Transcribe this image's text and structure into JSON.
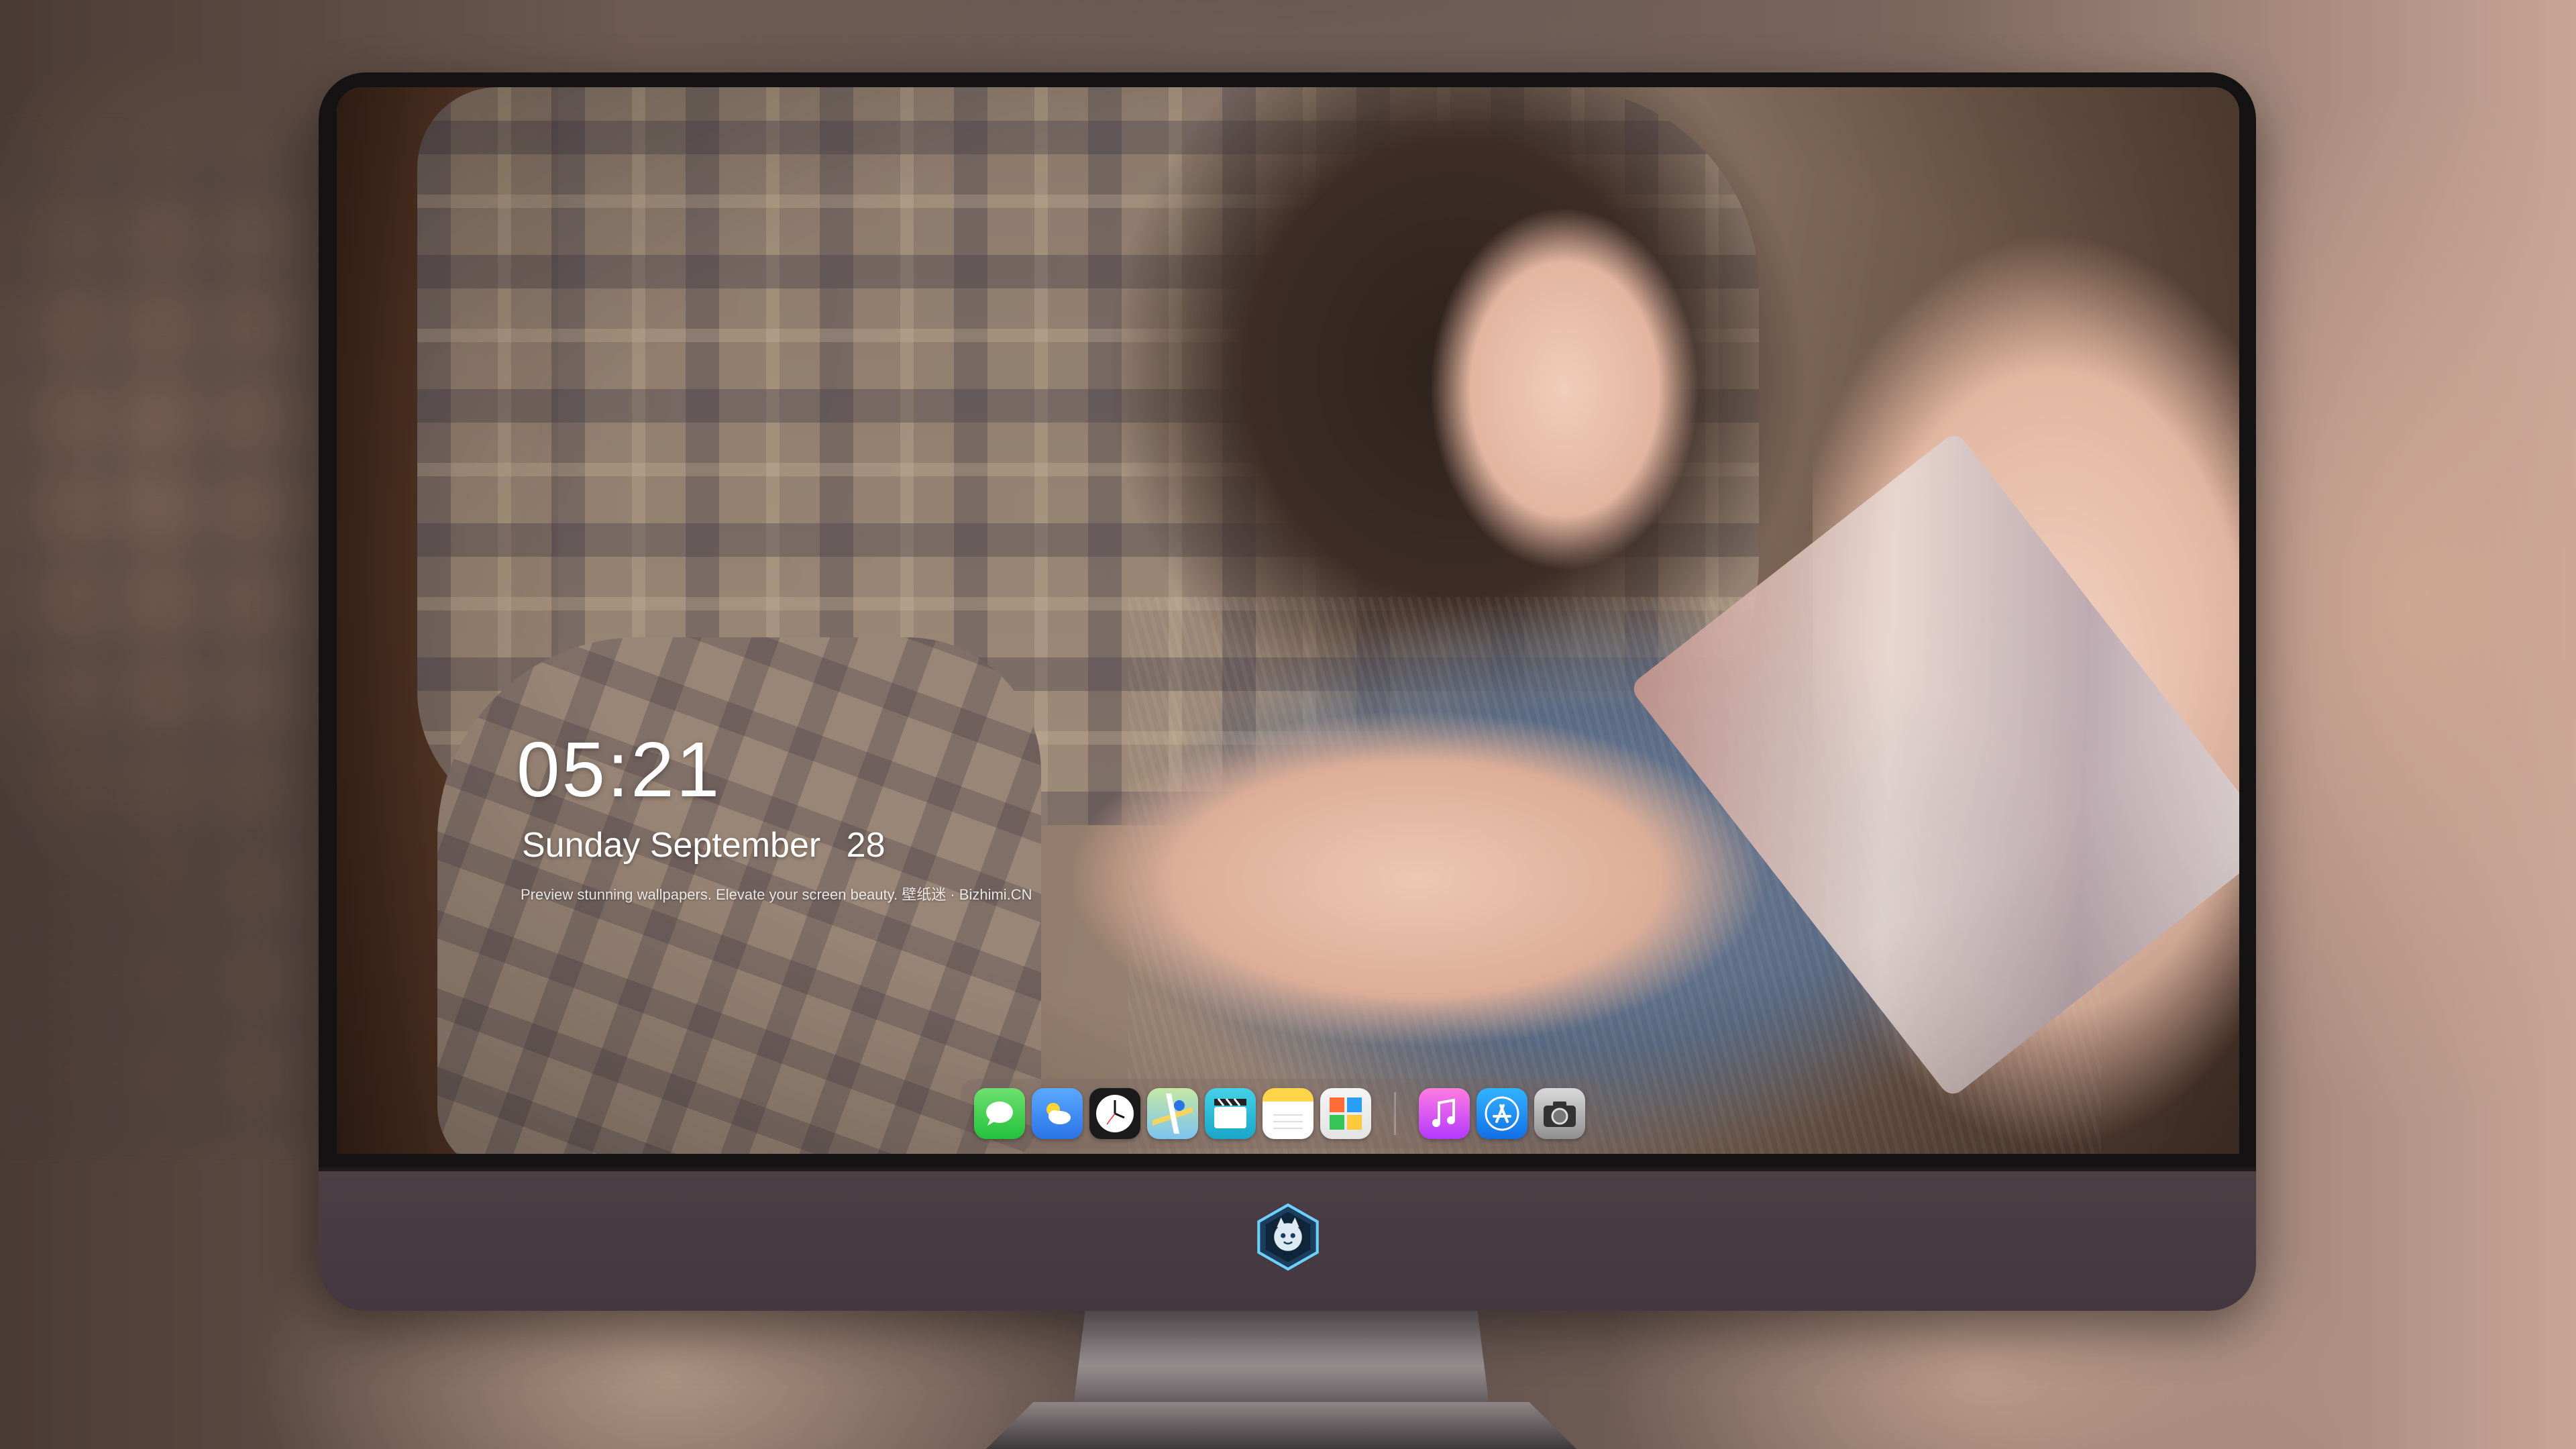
{
  "clock": {
    "time": "05:21",
    "weekday": "Sunday",
    "month": "September",
    "day": "28",
    "tagline": "Preview stunning wallpapers. Elevate your screen beauty. 壁纸迷 · Bizhimi.CN"
  },
  "dock": {
    "apps": [
      {
        "name": "Messages",
        "icon": "messages-icon",
        "color": "#28c840"
      },
      {
        "name": "Weather",
        "icon": "weather-icon",
        "color": "#2f7fe9"
      },
      {
        "name": "Clock",
        "icon": "clock-icon",
        "color": "#1a1a1a"
      },
      {
        "name": "Maps",
        "icon": "maps-icon",
        "color": "#7cc3f0"
      },
      {
        "name": "Clips",
        "icon": "clips-icon",
        "color": "#19a6c9"
      },
      {
        "name": "Notes",
        "icon": "notes-icon",
        "color": "#ffd54a"
      },
      {
        "name": "Tiles",
        "icon": "tiles-icon",
        "color": "#e3e3e3"
      },
      {
        "name": "Music",
        "icon": "music-icon",
        "color": "#c94bf5"
      },
      {
        "name": "App Store",
        "icon": "app-store-icon",
        "color": "#136fe6"
      },
      {
        "name": "Camera",
        "icon": "camera-icon",
        "color": "#8f8f8f"
      }
    ]
  },
  "monitor": {
    "logo": "monster-logo-icon"
  }
}
